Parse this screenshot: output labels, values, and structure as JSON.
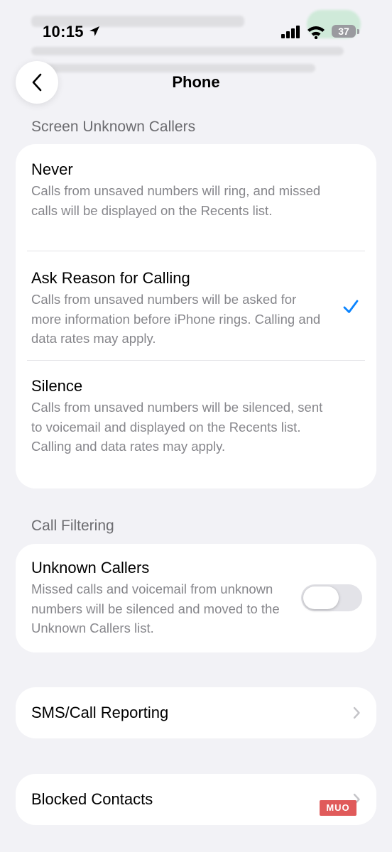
{
  "status_bar": {
    "time": "10:15",
    "battery": "37"
  },
  "nav": {
    "title": "Phone"
  },
  "screen_section": {
    "header": "Screen Unknown Callers",
    "options": [
      {
        "title": "Never",
        "desc": "Calls from unsaved numbers will ring, and missed calls will be displayed on the Recents list.",
        "selected": false
      },
      {
        "title": "Ask Reason for Calling",
        "desc": "Calls from unsaved numbers will be asked for more information before iPhone rings. Calling and data rates may apply.",
        "selected": true
      },
      {
        "title": "Silence",
        "desc": "Calls from unsaved numbers will be silenced, sent to voicemail and displayed on the Recents list. Calling and data rates may apply.",
        "selected": false
      }
    ]
  },
  "filtering_section": {
    "header": "Call Filtering",
    "title": "Unknown Callers",
    "desc": "Missed calls and voicemail from unknown numbers will be silenced and moved to the Unknown Callers list.",
    "toggle_on": false
  },
  "rows": {
    "sms_report": "SMS/Call Reporting",
    "blocked": "Blocked Contacts"
  },
  "watermark": "MUO",
  "colors": {
    "accent": "#0a84ff",
    "toggle_off": "#e3e3e8",
    "background": "#f2f2f6"
  }
}
